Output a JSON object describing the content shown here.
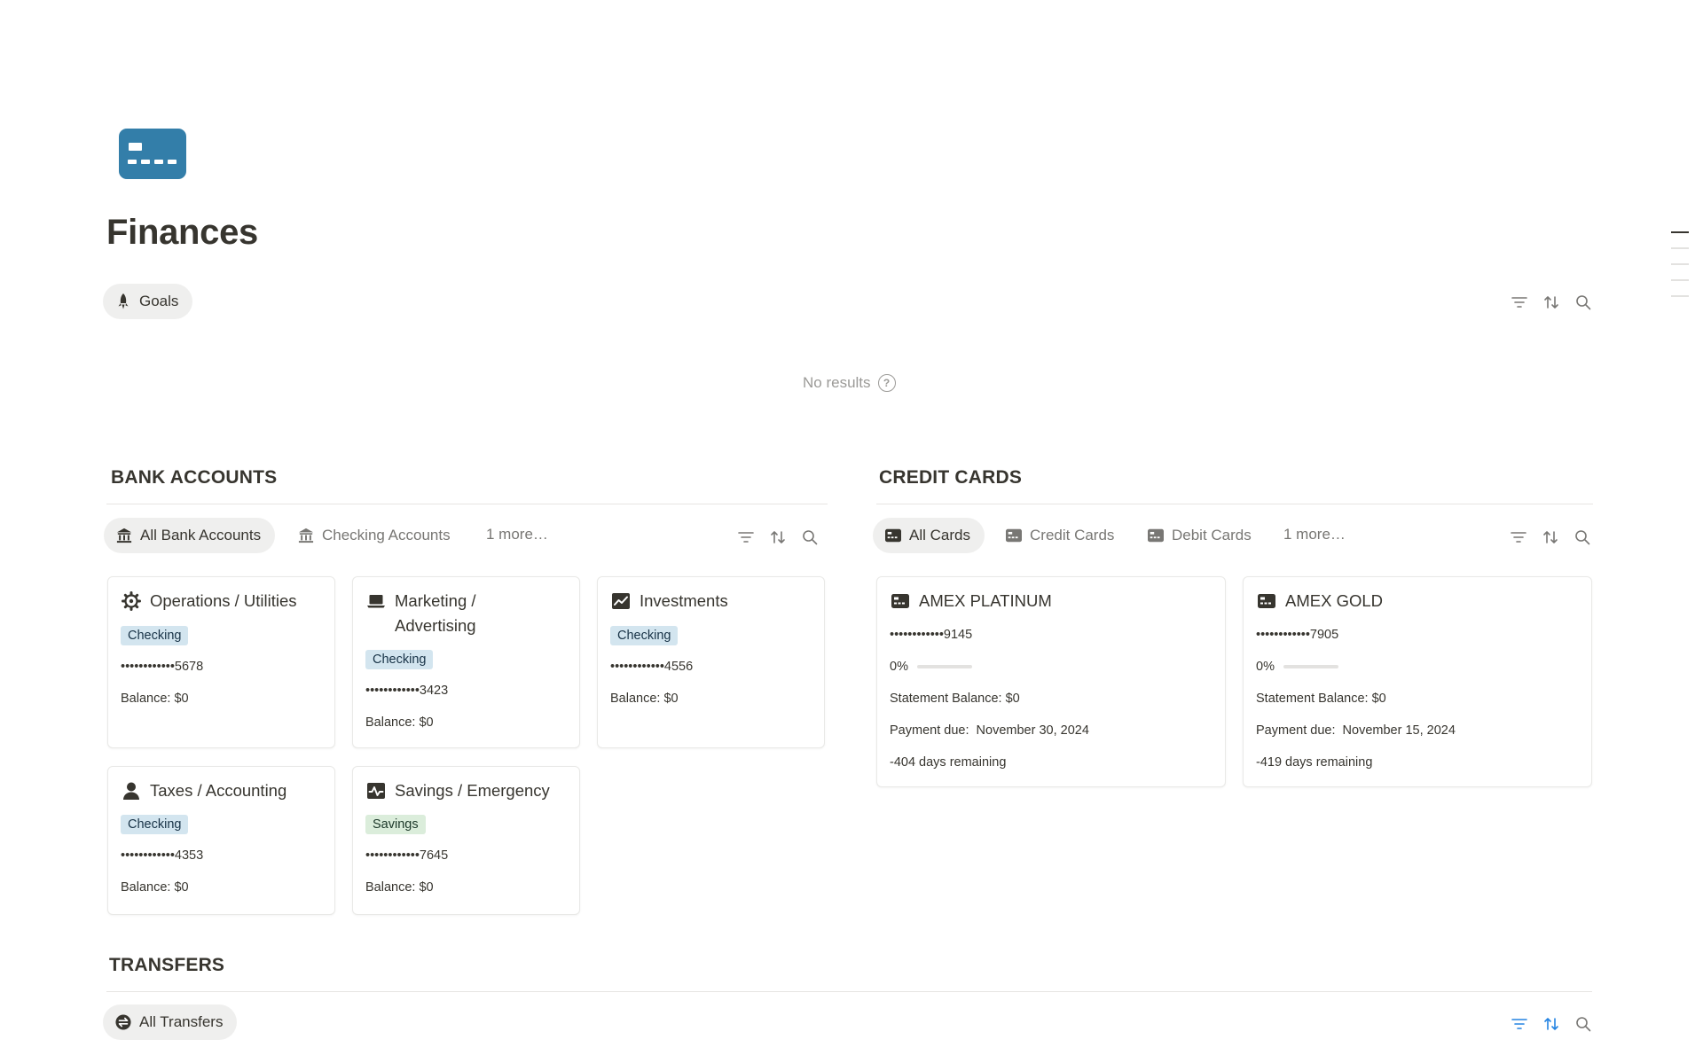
{
  "page": {
    "title": "Finances",
    "icon": "credit-card-icon",
    "accent_color": "#337ea9"
  },
  "goals": {
    "view_label": "Goals",
    "view_icon": "rocket-icon",
    "empty_text": "No results"
  },
  "bank_accounts": {
    "title": "BANK ACCOUNTS",
    "tabs": [
      {
        "label": "All Bank Accounts",
        "icon": "bank-icon",
        "active": true
      },
      {
        "label": "Checking Accounts",
        "icon": "bank-icon",
        "active": false
      }
    ],
    "more_label": "1 more…",
    "cards": [
      {
        "name": "Operations / Utilities",
        "icon": "gear-icon",
        "type": "Checking",
        "number": "••••••••••••5678",
        "balance": "Balance: $0"
      },
      {
        "name": "Marketing /",
        "name2": "Advertising",
        "icon": "laptop-icon",
        "type": "Checking",
        "number": "••••••••••••3423",
        "balance": "Balance: $0"
      },
      {
        "name": "Investments",
        "icon": "chart-line-icon",
        "type": "Checking",
        "number": "••••••••••••4556",
        "balance": "Balance: $0"
      },
      {
        "name": "Taxes / Accounting",
        "icon": "person-icon",
        "type": "Checking",
        "number": "••••••••••••4353",
        "balance": "Balance: $0"
      },
      {
        "name": "Savings / Emergency",
        "icon": "activity-icon",
        "type": "Savings",
        "number": "••••••••••••7645",
        "balance": "Balance: $0"
      }
    ]
  },
  "credit_cards": {
    "title": "CREDIT CARDS",
    "tabs": [
      {
        "label": "All Cards",
        "icon": "card-icon",
        "active": true
      },
      {
        "label": "Credit Cards",
        "icon": "card-icon",
        "active": false
      },
      {
        "label": "Debit Cards",
        "icon": "card-icon",
        "active": false
      }
    ],
    "more_label": "1 more…",
    "cards": [
      {
        "name": "AMEX PLATINUM",
        "icon": "card-icon",
        "number": "••••••••••••9145",
        "progress_label": "0%",
        "progress": 0,
        "statement": "Statement Balance: $0",
        "due_label": "Payment due:",
        "due_date": "November 30, 2024",
        "remaining": "-404 days remaining"
      },
      {
        "name": "AMEX GOLD",
        "icon": "card-icon",
        "number": "••••••••••••7905",
        "progress_label": "0%",
        "progress": 0,
        "statement": "Statement Balance: $0",
        "due_label": "Payment due:",
        "due_date": "November 15, 2024",
        "remaining": "-419 days remaining"
      }
    ]
  },
  "transfers": {
    "title": "TRANSFERS",
    "tabs": [
      {
        "label": "All Transfers",
        "icon": "transfer-icon",
        "active": true
      }
    ],
    "active_toolbar_color": "#2383e2"
  }
}
